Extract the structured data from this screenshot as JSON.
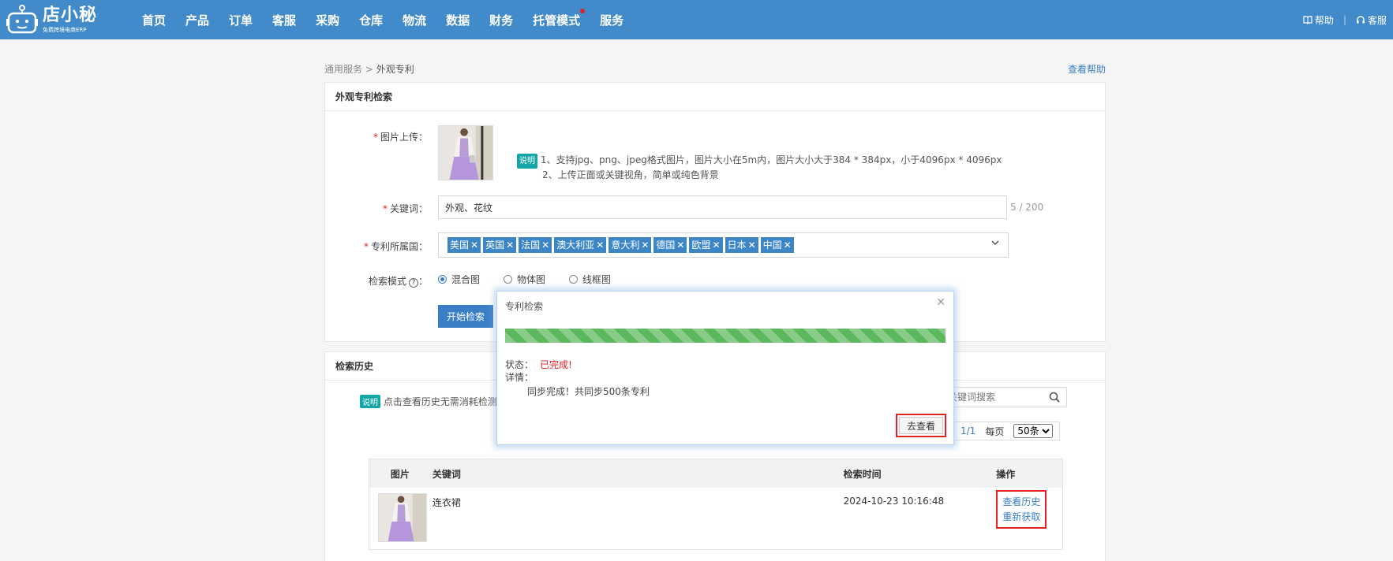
{
  "brand": {
    "name": "店小秘",
    "tagline": "免费跨境电商ERP"
  },
  "nav": {
    "items": [
      "首页",
      "产品",
      "订单",
      "客服",
      "采购",
      "仓库",
      "物流",
      "数据",
      "财务",
      "托管模式",
      "服务"
    ],
    "help": "帮助",
    "support": "客服"
  },
  "breadcrumb": {
    "parent": "通用服务",
    "sep": ">",
    "current": "外观专利"
  },
  "help_link": "查看帮助",
  "search_panel": {
    "title": "外观专利检索",
    "image_label": "图片上传：",
    "tip_badge": "说明",
    "tip_line1": "1、支持jpg、png、jpeg格式图片，图片大小在5m内，图片大小大于384 * 384px，小于4096px * 4096px",
    "tip_line2": "2、上传正面或关键视角，简单或纯色背景",
    "keyword_label": "关键词：",
    "keyword_value": "外观、花纹",
    "keyword_count": "5 / 200",
    "country_label": "专利所属国：",
    "countries": [
      "美国",
      "英国",
      "法国",
      "澳大利亚",
      "意大利",
      "德国",
      "欧盟",
      "日本",
      "中国"
    ],
    "mode_label": "检索模式",
    "mode_colon": "：",
    "modes": [
      "混合图",
      "物体图",
      "线框图"
    ],
    "selected_mode": "混合图",
    "search_button": "开始检索"
  },
  "history_panel": {
    "title": "检索历史",
    "tip_badge": "说明",
    "tip_text": "点击查看历史无需消耗检测",
    "search_placeholder": "关键词搜索",
    "pager_page": "1/1",
    "pager_per_page_label": "每页",
    "pager_per_page": "50条",
    "columns": [
      "图片",
      "关键词",
      "检索时间",
      "操作"
    ],
    "rows": [
      {
        "keyword": "连衣裙",
        "time": "2024-10-23 10:16:48",
        "actions": [
          "查看历史",
          "重新获取"
        ]
      }
    ]
  },
  "dialog": {
    "title": "专利检索",
    "progress": 1.0,
    "status_label": "状态：",
    "status_value": "已完成!",
    "detail_label": "详情：",
    "detail_text": "同步完成！共同步500条专利",
    "go_button": "去查看"
  },
  "colors": {
    "nav_bg": "#428bca",
    "primary": "#3a7fc6",
    "progress": "#5bb85c",
    "highlight": "#e52222",
    "badge": "#14a6a6"
  }
}
